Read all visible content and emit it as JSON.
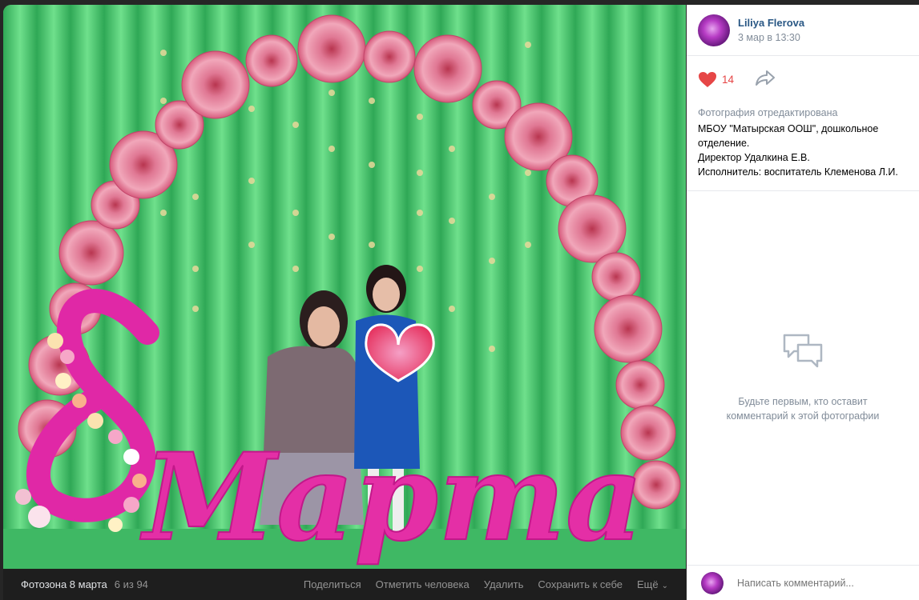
{
  "photo": {
    "title": "Фотозона 8 марта",
    "counter": "6 из 94",
    "scene_text": "Марта",
    "actions": {
      "share": "Поделиться",
      "tag": "Отметить человека",
      "delete": "Удалить",
      "save": "Сохранить к себе",
      "more": "Ещё"
    }
  },
  "post": {
    "author": "Liliya Flerova",
    "date": "3 мар в 13:30",
    "likes": "14",
    "edited_note": "Фотография отредактирована",
    "description_lines": [
      "МБОУ \"Матырская ООШ\", дошкольное",
      "отделение.",
      "Директор Удалкина Е.В.",
      "Исполнитель: воспитатель Клеменова Л.И."
    ]
  },
  "comments": {
    "empty_line1": "Будьте первым, кто оставит",
    "empty_line2": "комментарий к этой фотографии",
    "placeholder": "Написать комментарий..."
  },
  "colors": {
    "link": "#2a5885",
    "like": "#e64646",
    "muted": "#818c99"
  },
  "icons": {
    "like": "heart-icon",
    "share": "share-arrow-icon",
    "empty": "speech-bubbles-icon",
    "more": "chevron-down-icon"
  }
}
